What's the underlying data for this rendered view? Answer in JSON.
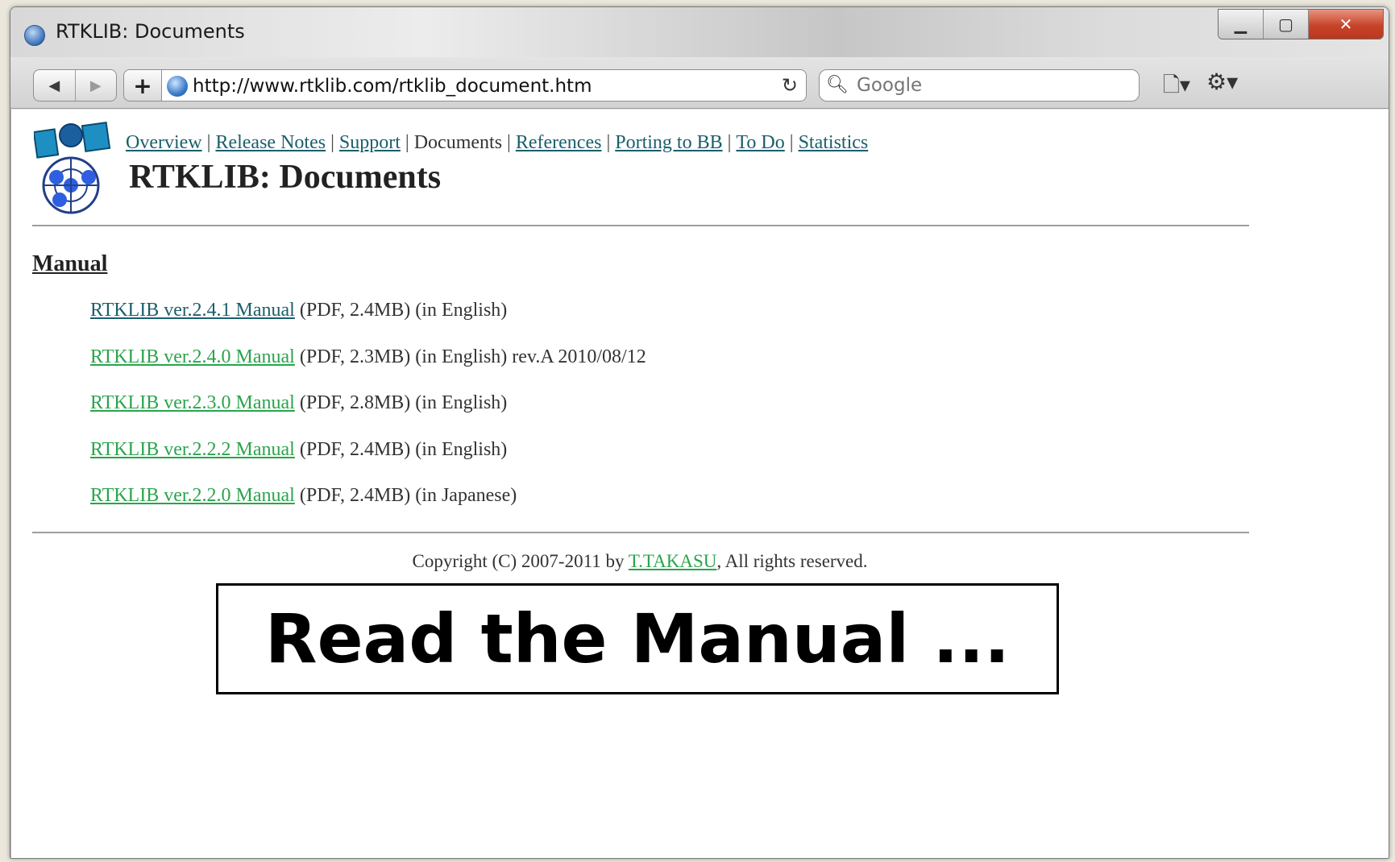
{
  "window": {
    "title": "RTKLIB: Documents"
  },
  "toolbar": {
    "back_label": "◀",
    "forward_label": "▶",
    "add_label": "+",
    "url": "http://www.rtklib.com/rtklib_document.htm",
    "reload_label": "↻",
    "search_placeholder": "Google",
    "page_menu_label": "🗋▾",
    "tools_menu_label": "⚙▾"
  },
  "nav": {
    "items": [
      "Overview",
      "Release Notes",
      "Support",
      "Documents",
      "References",
      "Porting to BB",
      "To Do",
      "Statistics"
    ],
    "current": "Documents"
  },
  "page": {
    "title": "RTKLIB: Documents",
    "section_heading": "Manual",
    "documents": [
      {
        "link": "RTKLIB ver.2.4.1 Manual",
        "info": "(PDF, 2.4MB) (in English)",
        "visited": false
      },
      {
        "link": "RTKLIB ver.2.4.0 Manual",
        "info": "(PDF, 2.3MB) (in English) rev.A 2010/08/12",
        "visited": true
      },
      {
        "link": "RTKLIB ver.2.3.0 Manual",
        "info": "(PDF, 2.8MB) (in English)",
        "visited": true
      },
      {
        "link": "RTKLIB ver.2.2.2 Manual",
        "info": "(PDF, 2.4MB) (in English)",
        "visited": true
      },
      {
        "link": "RTKLIB ver.2.2.0 Manual",
        "info": "(PDF, 2.4MB) (in Japanese)",
        "visited": true
      }
    ],
    "copyright_prefix": "Copyright (C) 2007-2011 by",
    "copyright_author": "T.TAKASU",
    "copyright_suffix": ", All rights reserved."
  },
  "callout": {
    "text": "Read the Manual ..."
  },
  "colors": {
    "link": "#1a5f6a",
    "visited_link": "#2aa44c",
    "close_button": "#c7442a"
  },
  "icons": [
    "browser-globe-icon",
    "back-icon",
    "forward-icon",
    "add-icon",
    "reload-icon",
    "search-icon",
    "page-menu-icon",
    "tools-gear-icon",
    "rtklib-logo"
  ]
}
